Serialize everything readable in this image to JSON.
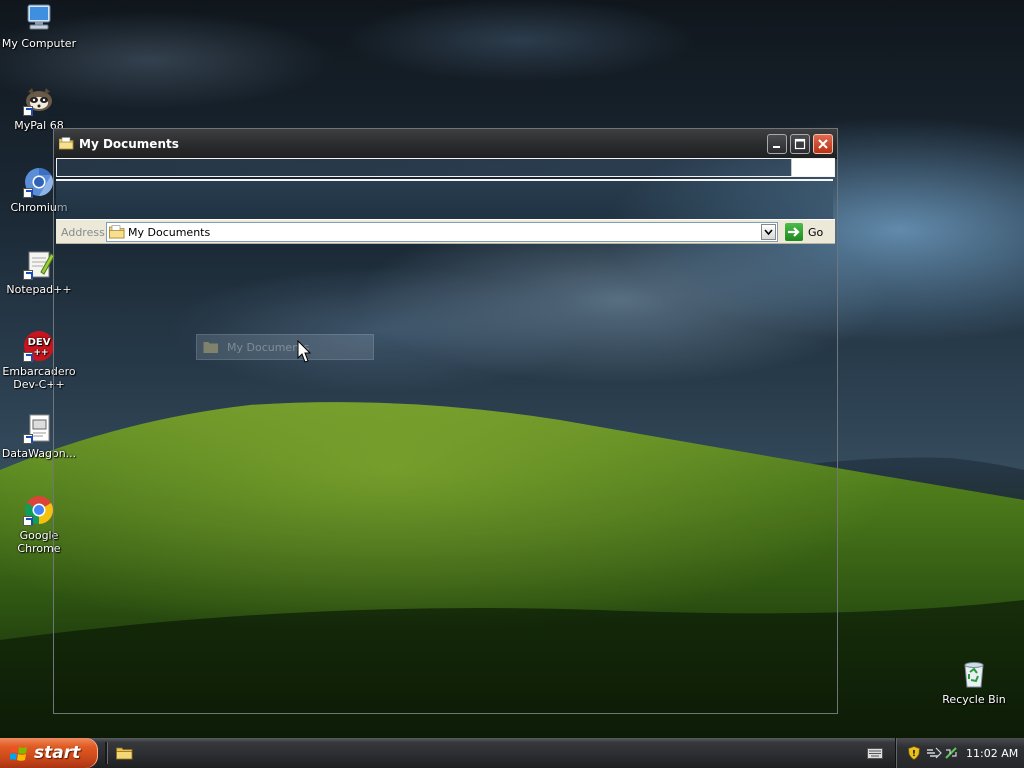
{
  "desktop": {
    "icons": [
      {
        "label": "My Computer",
        "icon": "computer-icon"
      },
      {
        "label": "MyPal 68",
        "icon": "mypal-raccoon-icon"
      },
      {
        "label": "Chromium",
        "icon": "chromium-icon"
      },
      {
        "label": "Notepad++",
        "icon": "notepadpp-icon"
      },
      {
        "label": "Embarcadero\nDev-C++",
        "icon": "devcpp-icon"
      },
      {
        "label": "DataWagon...",
        "icon": "datawagon-icon"
      },
      {
        "label": "Google Chrome",
        "icon": "chrome-icon"
      },
      {
        "label": "Recycle Bin",
        "icon": "recycle-bin-icon"
      }
    ]
  },
  "window": {
    "title": "My Documents",
    "address_label": "Address",
    "address_value": "My Documents",
    "go_label": "Go"
  },
  "drag": {
    "label": "My Documents"
  },
  "taskbar": {
    "start_label": "start",
    "clock": "11:02 AM"
  }
}
